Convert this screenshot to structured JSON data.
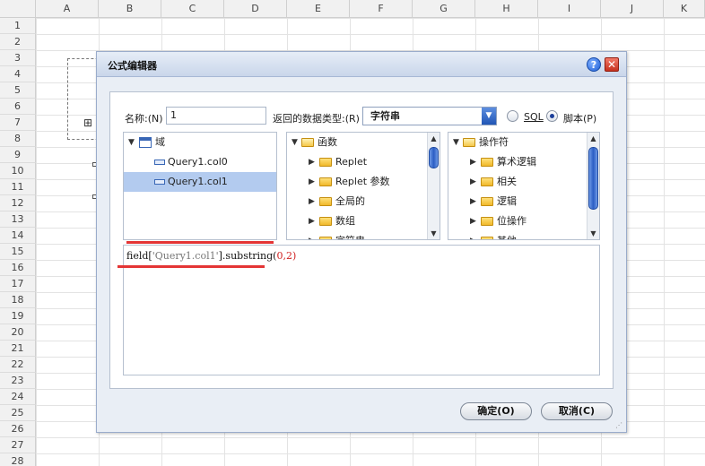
{
  "sheet": {
    "columns": [
      "A",
      "B",
      "C",
      "D",
      "E",
      "F",
      "G",
      "H",
      "I",
      "J",
      "K"
    ],
    "rows": [
      "1",
      "2",
      "3",
      "4",
      "5",
      "6",
      "7",
      "8",
      "9",
      "10",
      "11",
      "12",
      "13",
      "14",
      "15",
      "16",
      "17",
      "18",
      "19",
      "20",
      "21",
      "22",
      "23",
      "24",
      "25",
      "26",
      "27",
      "28"
    ]
  },
  "dialog": {
    "title": "公式编辑器",
    "help_glyph": "?",
    "close_glyph": "✕",
    "name_label": "名称:(N)",
    "name_value": "1",
    "return_type_label": "返回的数据类型:(R)",
    "return_type_value": "字符串",
    "radio_sql_label": "SQL",
    "radio_script_label": "脚本(P)",
    "selected_mode": "script",
    "fields_tree": {
      "root": "域",
      "items": [
        "Query1.col0",
        "Query1.col1"
      ],
      "selected_index": 1
    },
    "functions_tree": {
      "root": "函数",
      "items": [
        "Replet",
        "Replet 参数",
        "全局的",
        "数组",
        "字符串"
      ]
    },
    "operators_tree": {
      "root": "操作符",
      "items": [
        "算术逻辑",
        "相关",
        "逻辑",
        "位操作",
        "其他"
      ]
    },
    "expression": {
      "prefix": "field[",
      "string_literal": "'Query1.col1'",
      "middle": "].substring(",
      "arg1": "0",
      "comma": ",",
      "arg2": "2",
      "suffix": ")"
    },
    "ok_label": "确定(O)",
    "cancel_label": "取消(C)",
    "accent_red": "#e43535",
    "selection_color": "#b3cbef"
  }
}
